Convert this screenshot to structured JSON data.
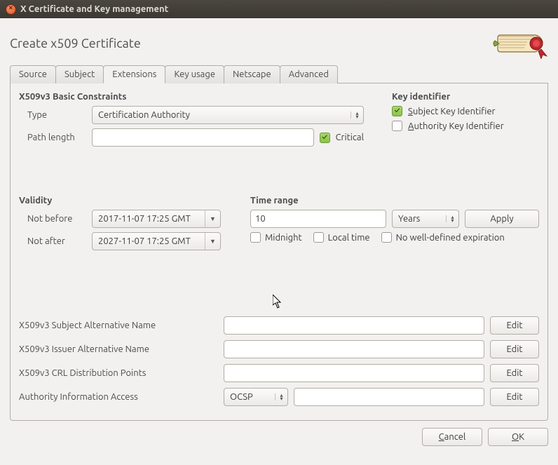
{
  "window": {
    "title": "X Certificate and Key management"
  },
  "page": {
    "title": "Create x509 Certificate"
  },
  "tabs": [
    "Source",
    "Subject",
    "Extensions",
    "Key usage",
    "Netscape",
    "Advanced"
  ],
  "active_tab": "Extensions",
  "basic_constraints": {
    "heading": "X509v3 Basic Constraints",
    "type_label": "Type",
    "type_value": "Certification Authority",
    "pathlen_label": "Path length",
    "pathlen_value": "",
    "critical_label": "Critical",
    "critical_checked": true
  },
  "key_identifier": {
    "heading": "Key identifier",
    "subject_label": "Subject Key Identifier",
    "subject_checked": true,
    "authority_label": "Authority Key Identifier",
    "authority_checked": false
  },
  "validity": {
    "heading": "Validity",
    "not_before_label": "Not before",
    "not_before_value": "2017-11-07 17:25 GMT",
    "not_after_label": "Not after",
    "not_after_value": "2027-11-07 17:25 GMT"
  },
  "time_range": {
    "heading": "Time range",
    "value": "10",
    "unit": "Years",
    "apply": "Apply",
    "midnight_label": "Midnight",
    "midnight_checked": false,
    "localtime_label": "Local time",
    "localtime_checked": false,
    "nowell_label": "No well-defined expiration",
    "nowell_checked": false
  },
  "ext_rows": {
    "san_label": "X509v3 Subject Alternative Name",
    "san_value": "",
    "ian_label": "X509v3 Issuer Alternative Name",
    "ian_value": "",
    "crl_label": "X509v3 CRL Distribution Points",
    "crl_value": "",
    "aia_label": "Authority Information Access",
    "aia_method": "OCSP",
    "aia_value": "",
    "edit": "Edit"
  },
  "footer": {
    "cancel": "Cancel",
    "ok": "OK"
  }
}
